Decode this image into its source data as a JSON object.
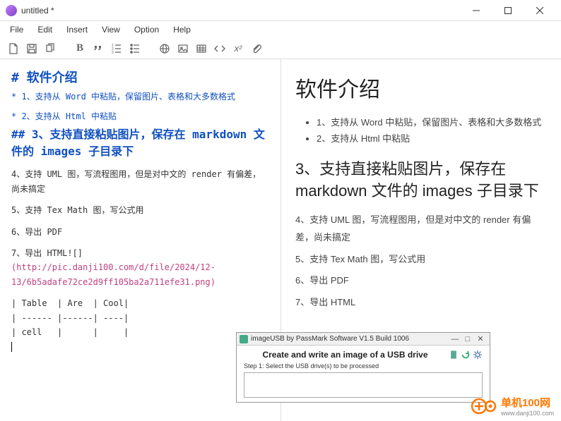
{
  "window": {
    "title": "untitled *"
  },
  "menu": [
    "File",
    "Edit",
    "Insert",
    "View",
    "Option",
    "Help"
  ],
  "toolbar_icons": [
    "new-file",
    "save",
    "copy",
    "bold",
    "quote",
    "ordered-list",
    "unordered-list",
    "globe",
    "image",
    "table",
    "code",
    "math",
    "attach"
  ],
  "editor": {
    "h1": "#  软件介绍",
    "b1": "* 1、支持从 Word 中粘贴，保留图片、表格和大多数格式",
    "b2": "* 2、支持从 Html 中粘贴",
    "h2": "## 3、支持直接粘贴图片，保存在 markdown 文件的 images 子目录下",
    "p4": "4、支持 UML 图，写流程图用，但是对中文的 render 有偏差，尚未搞定",
    "p5": "5、支持 Tex Math 图，写公式用",
    "p6": "6、导出 PDF",
    "p7": "7、导出 HTML![]",
    "link": "(http://pic.danji100.com/d/file/2024/12-13/6b5adafe72ce2d9ff105ba2a711efe31.png)",
    "table": "| Table  | Are  | Cool|\n| ------ |------| ----|\n| cell   |      |     |"
  },
  "preview": {
    "h1": "软件介绍",
    "li1": "1、支持从 Word 中粘贴，保留图片、表格和大多数格式",
    "li2": "2、支持从 Html 中粘贴",
    "h2": "3、支持直接粘贴图片，保存在 markdown 文件的 images 子目录下",
    "p4": "4、支持 UML 图，写流程图用，但是对中文的 render 有偏差，尚未搞定",
    "p5": "5、支持 Tex Math 图，写公式用",
    "p6": "6、导出 PDF",
    "p7": "7、导出 HTML"
  },
  "overlay": {
    "title": "imageUSB by PassMark Software V1.5 Build 1006",
    "heading": "Create and write an image of a USB drive",
    "step": "Step 1: Select the USB drive(s) to be processed"
  },
  "watermark": {
    "brand": "单机100网",
    "url": "www.danji100.com"
  }
}
